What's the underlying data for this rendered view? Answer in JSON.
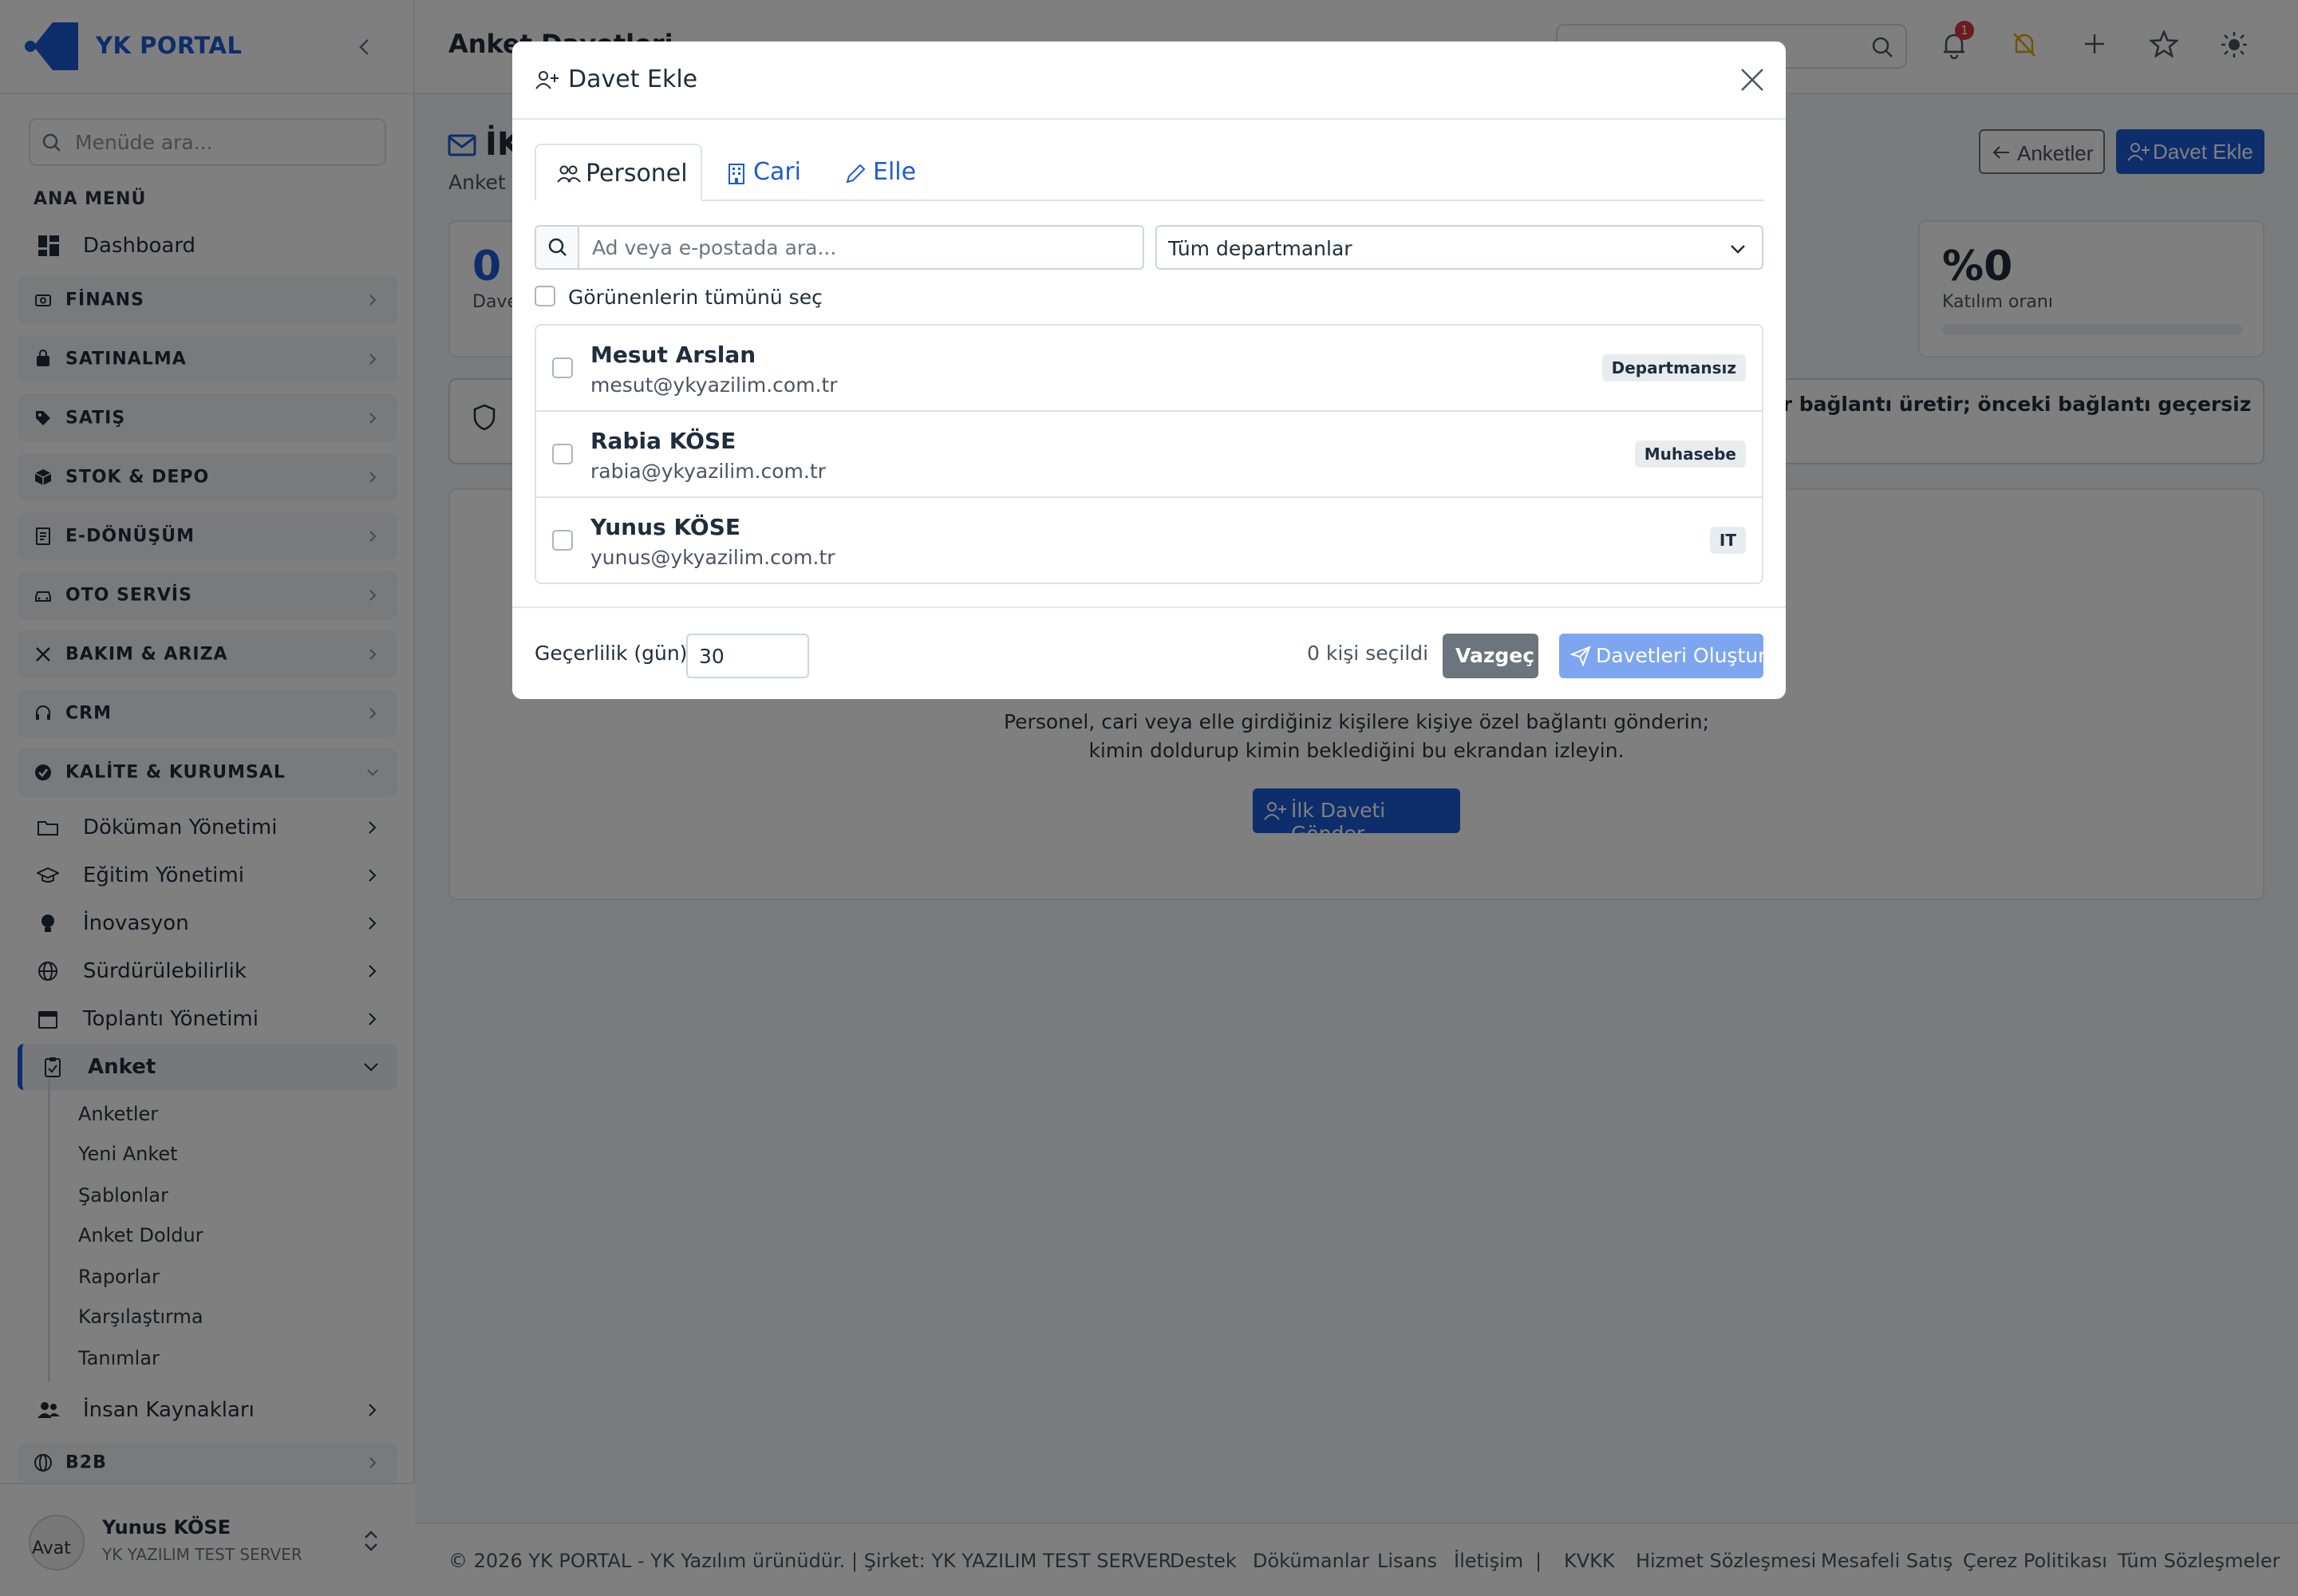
{
  "brand": {
    "name": "YK PORTAL"
  },
  "sidebar": {
    "search_placeholder": "Menüde ara...",
    "caption": "ANA MENÜ",
    "dashboard": "Dashboard",
    "groups": [
      "FİNANS",
      "SATINALMA",
      "SATIŞ",
      "STOK & DEPO",
      "E-DÖNÜŞÜM",
      "OTO SERVİS",
      "BAKIM & ARIZA",
      "CRM",
      "KALİTE & KURUMSAL"
    ],
    "kalite_items": [
      "Döküman Yönetimi",
      "Eğitim Yönetimi",
      "İnovasyon",
      "Sürdürülebilirlik",
      "Toplantı Yönetimi",
      "Anket"
    ],
    "anket_sub": [
      "Anketler",
      "Yeni Anket",
      "Şablonlar",
      "Anket Doldur",
      "Raporlar",
      "Karşılaştırma",
      "Tanımlar"
    ],
    "hr": "İnsan Kaynakları",
    "b2b": "B2B"
  },
  "user": {
    "name": "Yunus KÖSE",
    "company": "YK YAZILIM TEST SERVER",
    "avatar_alt": "Avat"
  },
  "topbar": {
    "title": "Anket Davetleri",
    "notification_count": "1"
  },
  "content": {
    "title": "İK",
    "subtitle": "Anket d",
    "back_button": "Anketler",
    "add_button": "Davet Ekle",
    "stats": [
      {
        "value": "0",
        "label": "Dave"
      },
      {
        "value": "%0",
        "label": "Katılım oranı"
      }
    ],
    "participation_fraction": 0,
    "info_text": "i bir bağlantı üretir; önceki bağlantı geçersiz",
    "empty_line1": "Personel, cari veya elle girdiğiniz kişilere kişiye özel bağlantı gönderin;",
    "empty_line2": "kimin doldurup kimin beklediğini bu ekrandan izleyin.",
    "first_invite_button": "İlk Daveti Gönder"
  },
  "footer": {
    "copyright": "© 2026 YK PORTAL - YK Yazılım ürünüdür. | Şirket: YK YAZILIM TEST SERVER",
    "links": [
      "Destek",
      "Dökümanlar",
      "Lisans",
      "İletişim",
      "KVKK",
      "Hizmet Sözleşmesi",
      "Mesafeli Satış",
      "Çerez Politikası",
      "Tüm Sözleşmeler"
    ]
  },
  "modal": {
    "title": "Davet Ekle",
    "tabs": [
      "Personel",
      "Cari",
      "Elle"
    ],
    "search_placeholder": "Ad veya e-postada ara...",
    "department_select": "Tüm departmanlar",
    "select_all": "Görünenlerin tümünü seç",
    "people": [
      {
        "name": "Mesut Arslan",
        "email": "mesut@ykyazilim.com.tr",
        "department": "Departmansız"
      },
      {
        "name": "Rabia KÖSE",
        "email": "rabia@ykyazilim.com.tr",
        "department": "Muhasebe"
      },
      {
        "name": "Yunus KÖSE",
        "email": "yunus@ykyazilim.com.tr",
        "department": "IT"
      }
    ],
    "validity_label": "Geçerlilik (gün)",
    "validity_value": "30",
    "selected_count": "0 kişi seçildi",
    "cancel_button": "Vazgeç",
    "create_button": "Davetleri Oluştur"
  },
  "colors": {
    "primary": "#1d5bd6",
    "danger": "#dc3545",
    "secondary": "#6c757d",
    "primary_disabled": "#7ea6f0"
  }
}
